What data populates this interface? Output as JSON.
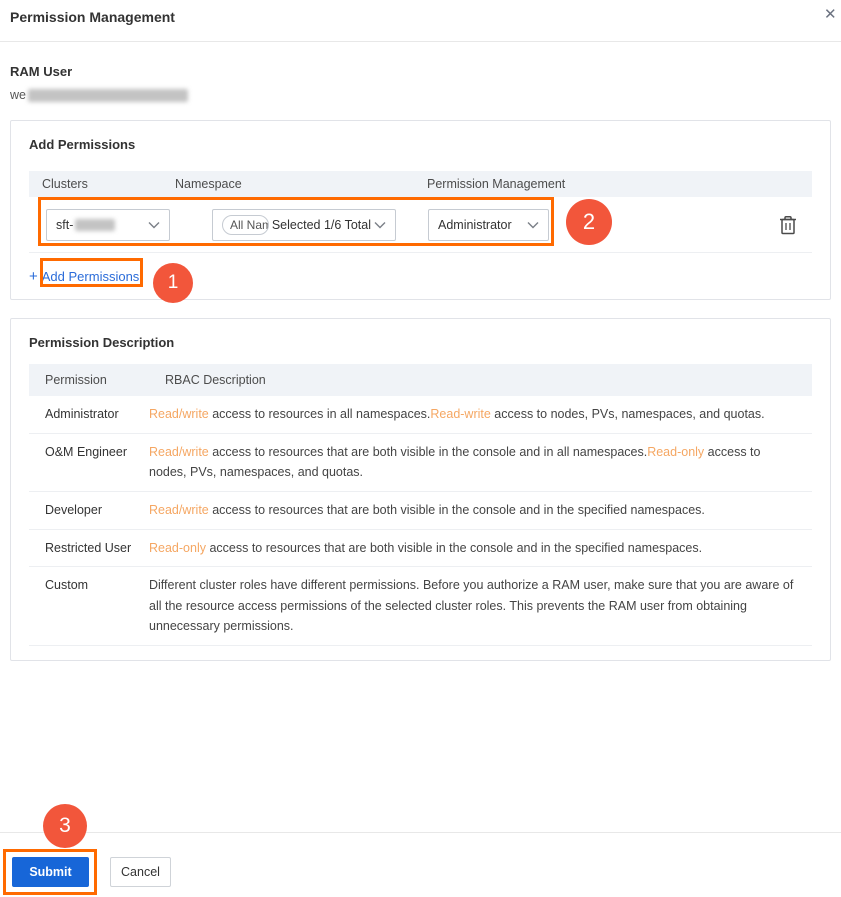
{
  "dialog": {
    "title": "Permission Management",
    "close_glyph": "✕"
  },
  "ram_user": {
    "label": "RAM User",
    "value_prefix": "we"
  },
  "add_permissions": {
    "title": "Add Permissions",
    "columns": [
      "Clusters",
      "Namespace",
      "Permission Management"
    ],
    "row": {
      "cluster_prefix": "sft-",
      "namespace_tag": "All Nam",
      "namespace_value": "Selected 1/6 Total",
      "permission_value": "Administrator"
    },
    "add_plus": "+",
    "add_link_label": "Add Permissions"
  },
  "permission_description": {
    "title": "Permission Description",
    "columns": [
      "Permission",
      "RBAC Description"
    ],
    "rows": [
      {
        "permission": "Administrator",
        "seg0": "Read/write",
        "seg1": " access to resources in all namespaces.",
        "seg2": "Read-write",
        "seg3": " access to nodes, PVs, namespaces, and quotas."
      },
      {
        "permission": "O&M Engineer",
        "seg0": "Read/write",
        "seg1": " access to resources that are both visible in the console and in all namespaces.",
        "seg2": "Read-only",
        "seg3": " access to nodes, PVs, namespaces, and quotas."
      },
      {
        "permission": "Developer",
        "seg0": "Read/write",
        "seg1": " access to resources that are both visible in the console and in the specified namespaces."
      },
      {
        "permission": "Restricted User",
        "seg0": "Read-only",
        "seg1": " access to resources that are both visible in the console and in the specified namespaces."
      },
      {
        "permission": "Custom",
        "seg1": "Different cluster roles have different permissions. Before you authorize a RAM user, make sure that you are aware of all the resource access permissions of the selected cluster roles. This prevents the RAM user from obtaining unnecessary permissions."
      }
    ]
  },
  "annotations": {
    "step1": "1",
    "step2": "2",
    "step3": "3"
  },
  "footer": {
    "submit_label": "Submit",
    "cancel_label": "Cancel"
  },
  "colors": {
    "highlight_frame": "#ff6a00",
    "badge": "#f2563b",
    "link_blue": "#2b6cd9",
    "submit_blue": "#1766d8",
    "orange_text": "#f5a763"
  }
}
